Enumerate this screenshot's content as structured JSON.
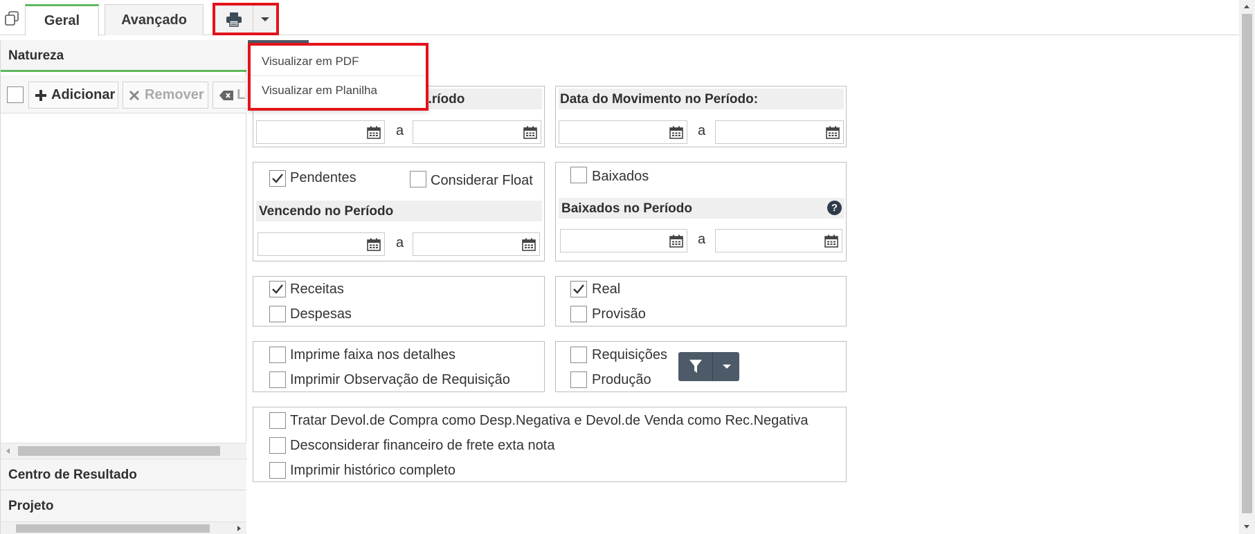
{
  "tabs": [
    {
      "label": "Geral",
      "active": true
    },
    {
      "label": "Avançado",
      "active": false
    }
  ],
  "print_menu": {
    "items": [
      "Visualizar em PDF",
      "Visualizar em Planilha"
    ]
  },
  "left_panel": {
    "sections": [
      "Natureza",
      "Centro de Resultado",
      "Projeto"
    ],
    "toolbar": {
      "add_label": "Adicionar",
      "remove_label": "Remover",
      "clear_label": "Li"
    }
  },
  "form": {
    "period1": {
      "title": "...ríodo",
      "separator": "a"
    },
    "period2": {
      "title": "Data do Movimento no Período:",
      "separator": "a"
    },
    "pendentes": {
      "label": "Pendentes",
      "checked": true
    },
    "considerar_float": {
      "label": "Considerar Float",
      "checked": false
    },
    "vencendo": {
      "title": "Vencendo no Período",
      "separator": "a"
    },
    "baixados": {
      "label": "Baixados",
      "checked": false
    },
    "baixados_periodo": {
      "title": "Baixados no Período",
      "separator": "a",
      "help": "?"
    },
    "receitas": {
      "label": "Receitas",
      "checked": true
    },
    "despesas": {
      "label": "Despesas",
      "checked": false
    },
    "real": {
      "label": "Real",
      "checked": true
    },
    "provisao": {
      "label": "Provisão",
      "checked": false
    },
    "imprime_faixa": {
      "label": "Imprime faixa nos detalhes",
      "checked": false
    },
    "imprimir_obs": {
      "label": "Imprimir Observação de Requisição",
      "checked": false
    },
    "requisicoes": {
      "label": "Requisições",
      "checked": false
    },
    "producao": {
      "label": "Produção",
      "checked": false
    },
    "tratar_devol": {
      "label": "Tratar Devol.de Compra como Desp.Negativa e Devol.de Venda como Rec.Negativa",
      "checked": false
    },
    "desconsiderar_frete": {
      "label": "Desconsiderar financeiro de frete exta nota",
      "checked": false
    },
    "historico_completo": {
      "label": "Imprimir histórico completo",
      "checked": false
    }
  },
  "colors": {
    "highlight": "#e3131b",
    "active_tab": "#5cb85c",
    "filter_button": "#4d5a68"
  },
  "icons": [
    "copy-icon",
    "printer-icon",
    "caret-down-icon",
    "plus-icon",
    "times-icon",
    "eraser-icon",
    "calendar-icon",
    "check-icon",
    "help-icon",
    "filter-icon"
  ]
}
